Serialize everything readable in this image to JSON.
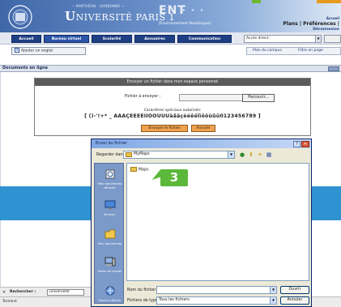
{
  "header": {
    "uni_small": "— PANTHÉON - SORBONNE —",
    "uni_letter_u": "U",
    "uni_rest": "NIVERSITÉ PARIS 1",
    "ent_logo": "ENT",
    "ent_arrows": "▸ ▸ ▸",
    "ent_sub": "[Environnement Numérique]",
    "account": "Accueil",
    "user_links": "Plans | Préférences |",
    "logout": "Déconnexion"
  },
  "nav": {
    "tabs": [
      "Accueil",
      "Bureau virtuel",
      "Scolarité",
      "Annuaires",
      "Communication"
    ],
    "active_index": 1,
    "quick_access": "Accès direct :"
  },
  "subbar": {
    "add_tab": "Ajouter un onglet",
    "links": [
      "Plan du campus",
      "Filtre en page"
    ]
  },
  "portlet": {
    "title": "Documents en ligne"
  },
  "upload": {
    "header": "Envoyer un fichier dans mon espace personnel",
    "file_label": "Fichier à envoyer :",
    "browse": "Parcourir...",
    "special_label": "Caractères spéciaux autorisés:",
    "special_chars": "[ ()-'!+* _ ÀÂÄÇÈÉÊËÎÏÔÖÙÛÜàâäçèéêëîïôöùûü0123456789 ]",
    "send": "Envoyer le fichier",
    "cancel": "Annuler"
  },
  "dialog": {
    "title": "Envoi du fichier",
    "help": "?",
    "close": "✕",
    "look_in_label": "Regarder dans :",
    "look_in_value": "MyMaps",
    "places": [
      "Mes documents récents",
      "Bureau",
      "Mes documents",
      "Poste de travail",
      "Favoris réseau"
    ],
    "file_name": "Maps",
    "name_label": "Nom du fichier :",
    "type_label": "Fichiers de type :",
    "type_value": "Tous les fichiers",
    "open_btn": "Ouvrir",
    "cancel_btn": "Annuler"
  },
  "search_bar": {
    "close": "✕",
    "label": "Rechercher :",
    "value": "universelle"
  },
  "status": {
    "text": "Terminé"
  },
  "step_badge": "3",
  "colors": {
    "header_blue": "#3f67a8",
    "nav_tab": "#1f3f84",
    "step_green": "#5cb83a",
    "accent_orange": "#f1a14d",
    "page_band": "#2f93d1"
  }
}
